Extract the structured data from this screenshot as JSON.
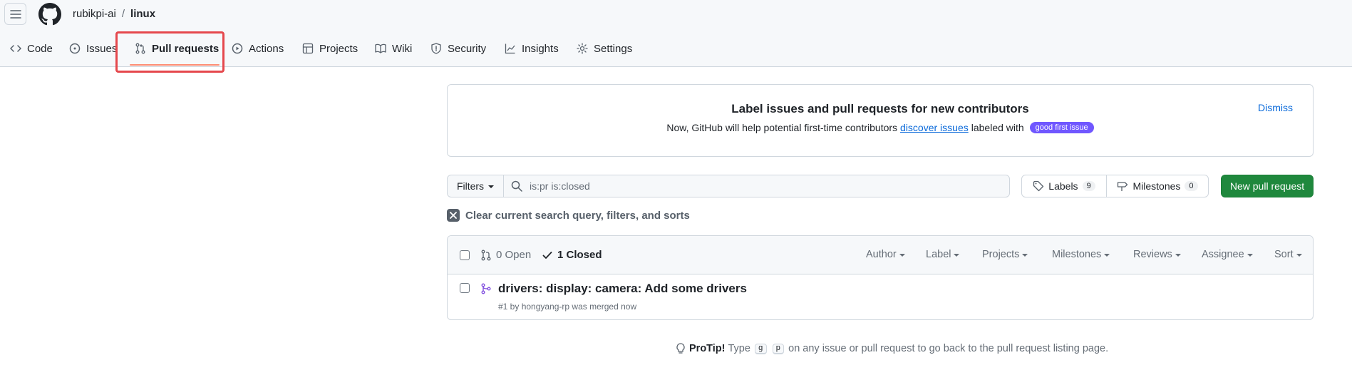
{
  "header": {
    "owner": "rubikpi-ai",
    "separator": "/",
    "repo": "linux"
  },
  "nav": {
    "code": "Code",
    "issues": "Issues",
    "pull_requests": "Pull requests",
    "actions": "Actions",
    "projects": "Projects",
    "wiki": "Wiki",
    "security": "Security",
    "insights": "Insights",
    "settings": "Settings"
  },
  "banner": {
    "title": "Label issues and pull requests for new contributors",
    "text_before": "Now, GitHub will help potential first-time contributors",
    "link": "discover issues",
    "text_after": "labeled with",
    "label": "good first issue",
    "dismiss": "Dismiss"
  },
  "filters": {
    "button": "Filters",
    "query": "is:pr is:closed",
    "labels": "Labels",
    "labels_count": "9",
    "milestones": "Milestones",
    "milestones_count": "0",
    "new_pr": "New pull request",
    "clear": "Clear current search query, filters, and sorts"
  },
  "list": {
    "open": "0 Open",
    "closed": "1 Closed",
    "sorts": [
      "Author",
      "Label",
      "Projects",
      "Milestones",
      "Reviews",
      "Assignee",
      "Sort"
    ],
    "rows": [
      {
        "title": "drivers: display: camera: Add some drivers",
        "meta": "#1 by hongyang-rp was merged now"
      }
    ]
  },
  "protip": {
    "label": "ProTip!",
    "text1": "Type",
    "key1": "g",
    "key2": "p",
    "text2": "on any issue or pull request to go back to the pull request listing page."
  },
  "colors": {
    "accent": "#0969da",
    "primary_button": "#1f883d",
    "highlight": "#e5484d",
    "merged": "#8250df",
    "good_first_issue": "#7057ff"
  }
}
